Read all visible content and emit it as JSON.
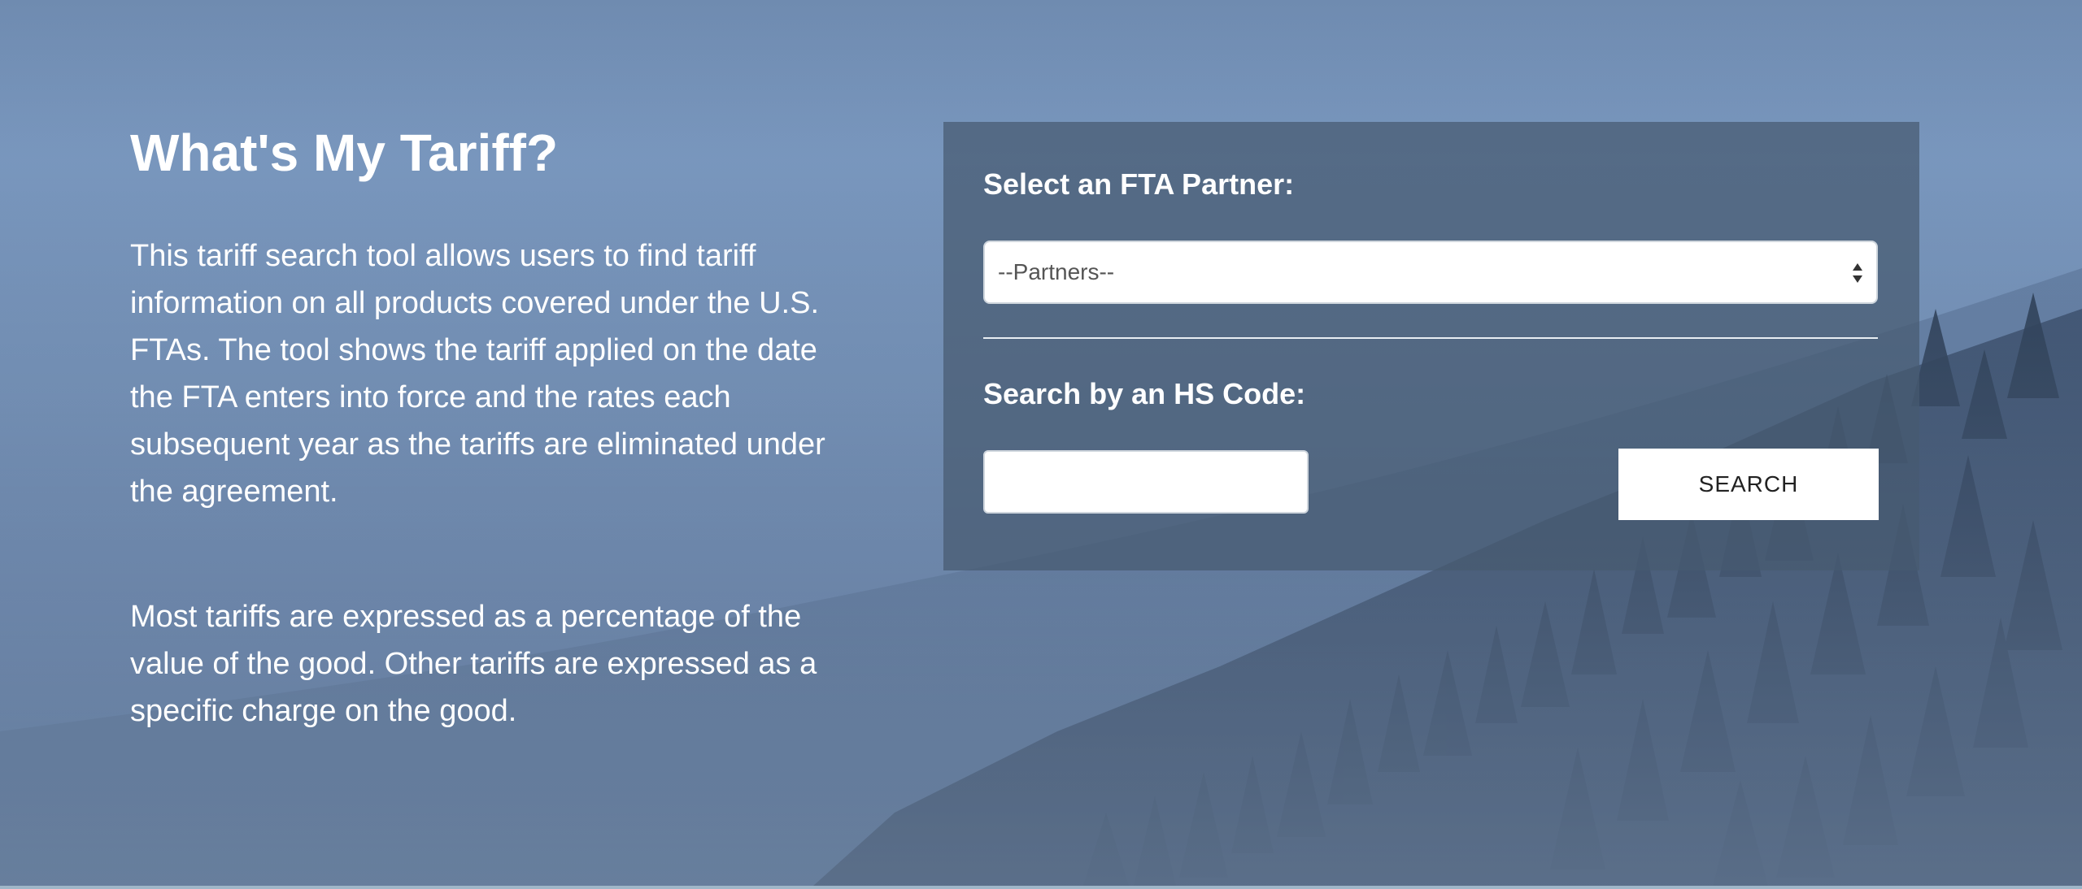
{
  "intro": {
    "title": "What's My Tariff?",
    "paragraph1": "This tariff search tool allows users to find tariff information on all products covered under the U.S. FTAs. The tool shows the tariff applied on the date the FTA enters into force and the rates each subsequent year as the tariffs are eliminated under the agreement.",
    "paragraph2": "Most tariffs are expressed as a percentage of the value of the good. Other tariffs are expressed as a specific charge on the good."
  },
  "search_panel": {
    "partner_label": "Select an FTA Partner:",
    "partner_select_value": "--Partners--",
    "hs_label": "Search by an HS Code:",
    "hs_input_value": "",
    "search_button_label": "SEARCH"
  },
  "colors": {
    "panel_background": "#465a70",
    "sky_blue": "#7896bd",
    "forest_dark": "#1f2f45"
  }
}
